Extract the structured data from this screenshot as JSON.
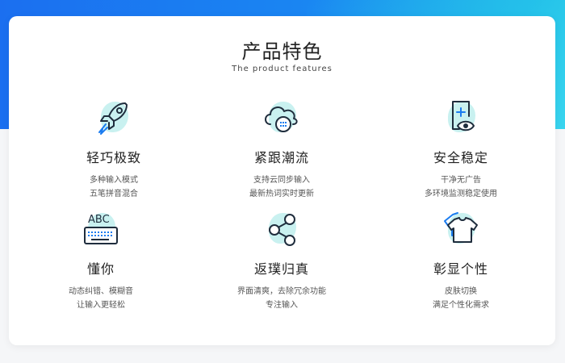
{
  "section": {
    "title": "产品特色",
    "subtitle": "The product features"
  },
  "features": [
    {
      "icon": "rocket-icon",
      "name": "轻巧极致",
      "lines": [
        "多种输入模式",
        "五笔拼音混合"
      ]
    },
    {
      "icon": "cloud-sync-icon",
      "name": "紧跟潮流",
      "lines": [
        "支持云同步输入",
        "最新热词实时更新"
      ]
    },
    {
      "icon": "secure-document-icon",
      "name": "安全稳定",
      "lines": [
        "干净无广告",
        "多环境监测稳定使用"
      ]
    },
    {
      "icon": "keyboard-icon",
      "name": "懂你",
      "lines": [
        "动态纠错、模糊音",
        "让输入更轻松"
      ]
    },
    {
      "icon": "share-icon",
      "name": "返璞归真",
      "lines": [
        "界面清爽，去除冗余功能",
        "专注输入"
      ]
    },
    {
      "icon": "tshirt-icon",
      "name": "彰显个性",
      "lines": [
        "皮肤切换",
        "满足个性化需求"
      ]
    }
  ],
  "keyboard_icon_text": "ABC",
  "colors": {
    "accent": "#1a7cf0",
    "icon_stroke": "#1f2d3d",
    "blob": "#c9f1f0"
  }
}
